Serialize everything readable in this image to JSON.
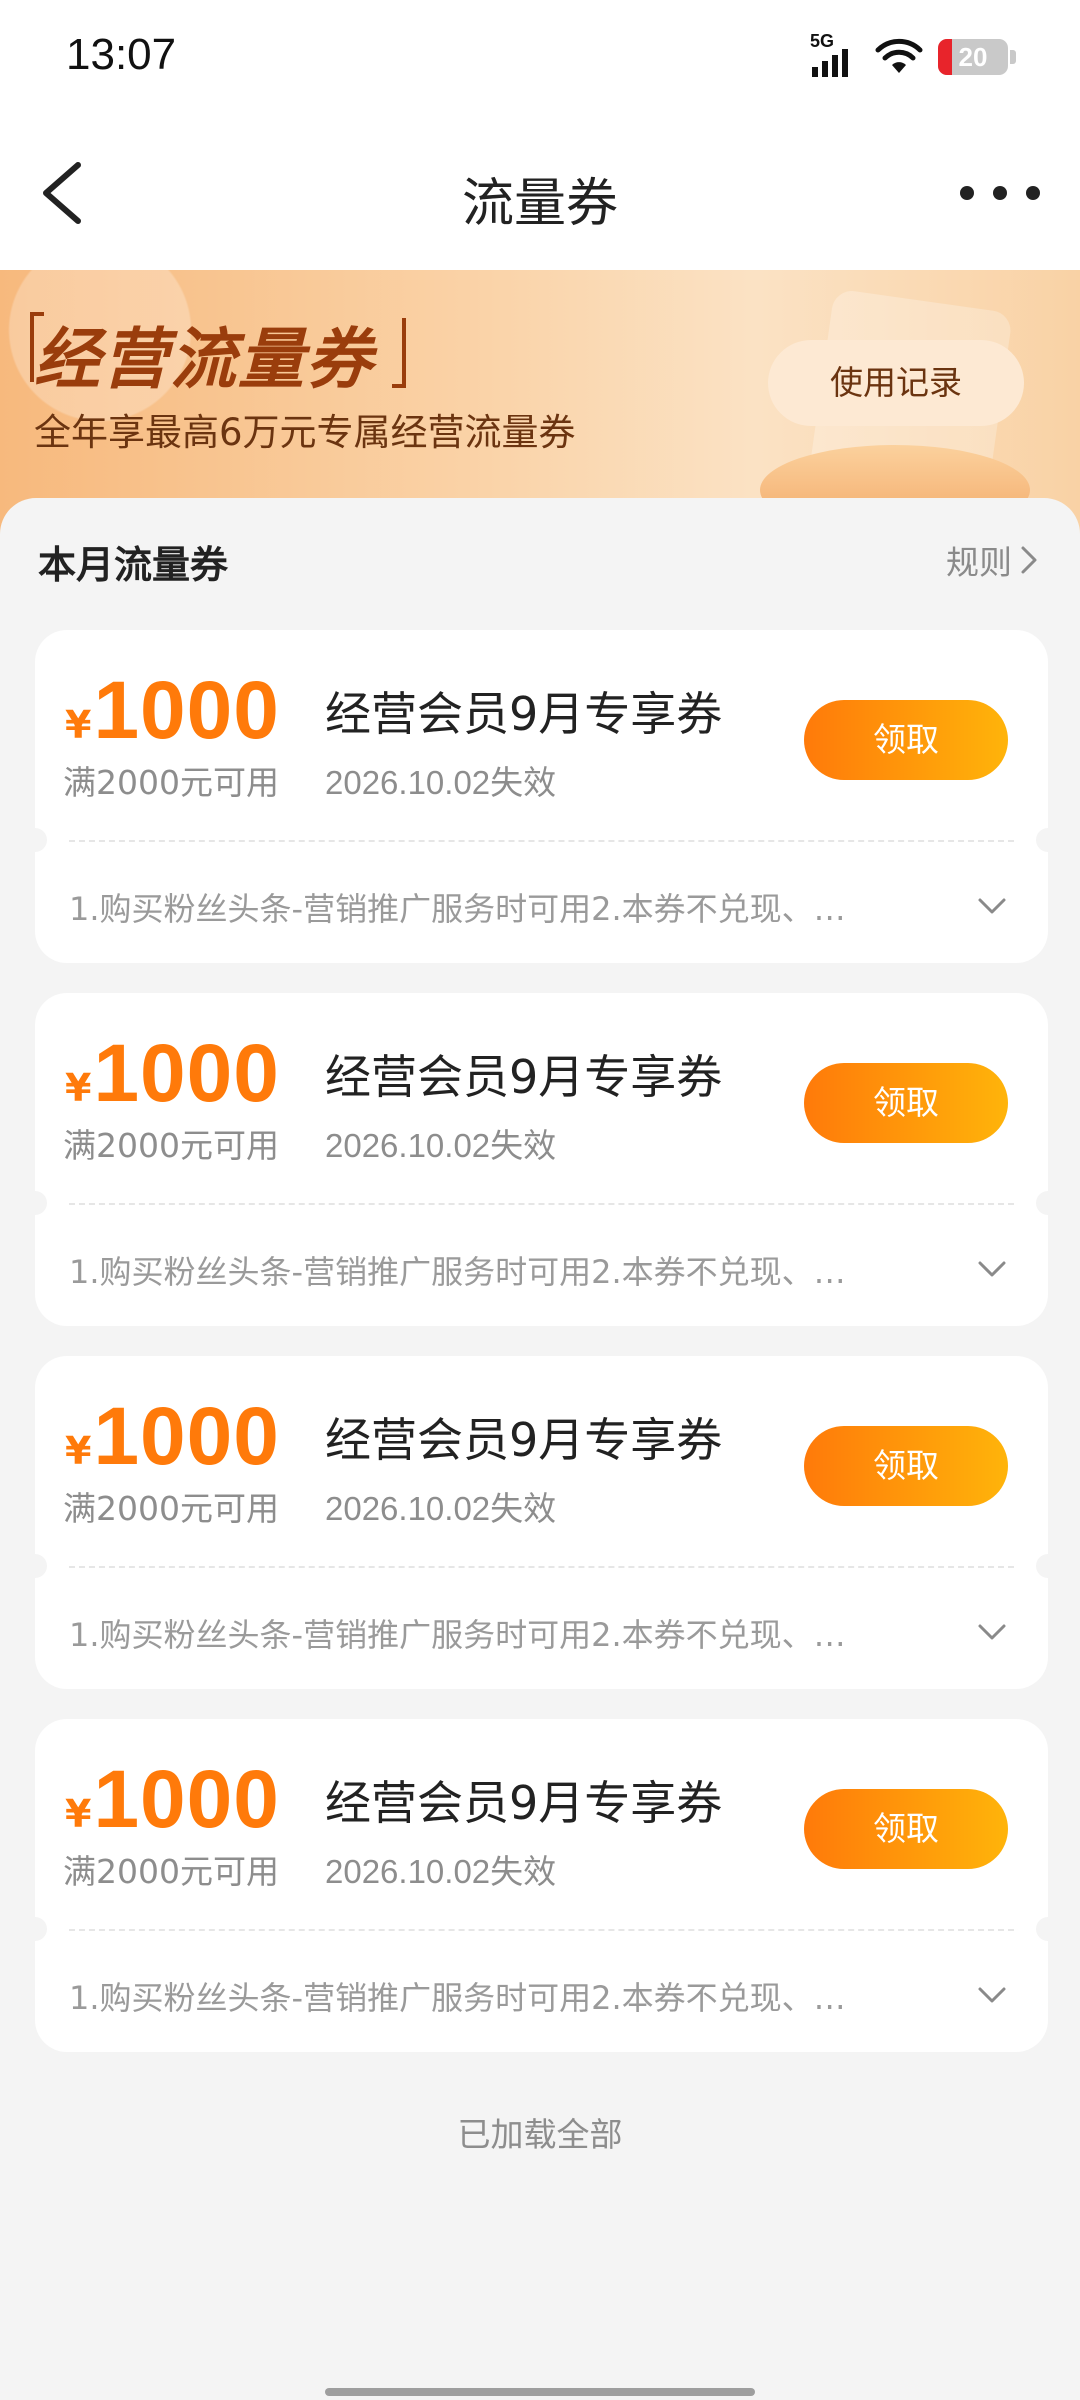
{
  "status_bar": {
    "time": "13:07",
    "network": "5G",
    "battery": "20",
    "icons": [
      "signal-icon",
      "wifi-icon",
      "battery-icon"
    ]
  },
  "nav": {
    "title": "流量券",
    "back_icon": "chevron-left-icon",
    "more_icon": "more-dots-icon"
  },
  "banner": {
    "title": "经营流量券",
    "subtitle": "全年享最高6万元专属经营流量券",
    "record_button": "使用记录"
  },
  "section": {
    "title": "本月流量券",
    "rules_label": "规则",
    "rules_icon": "chevron-right-icon"
  },
  "coupons": [
    {
      "currency": "¥",
      "amount": "1000",
      "condition": "满2000元可用",
      "name": "经营会员9月专享券",
      "expiry": "2026.10.02失效",
      "button": "领取",
      "description": "1.购买粉丝头条-营销推广服务时可用2.本券不兑现、…"
    },
    {
      "currency": "¥",
      "amount": "1000",
      "condition": "满2000元可用",
      "name": "经营会员9月专享券",
      "expiry": "2026.10.02失效",
      "button": "领取",
      "description": "1.购买粉丝头条-营销推广服务时可用2.本券不兑现、…"
    },
    {
      "currency": "¥",
      "amount": "1000",
      "condition": "满2000元可用",
      "name": "经营会员9月专享券",
      "expiry": "2026.10.02失效",
      "button": "领取",
      "description": "1.购买粉丝头条-营销推广服务时可用2.本券不兑现、…"
    },
    {
      "currency": "¥",
      "amount": "1000",
      "condition": "满2000元可用",
      "name": "经营会员9月专享券",
      "expiry": "2026.10.02失效",
      "button": "领取",
      "description": "1.购买粉丝头条-营销推广服务时可用2.本券不兑现、…"
    }
  ],
  "footer": {
    "loaded_all": "已加载全部"
  },
  "colors": {
    "accent": "#ff7a0a",
    "accent_end": "#ffb40a",
    "banner_text": "#9a3d0c"
  }
}
